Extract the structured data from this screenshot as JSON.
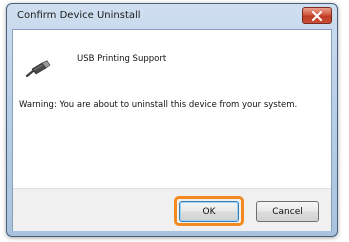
{
  "window": {
    "title": "Confirm Device Uninstall",
    "close_icon": "close-icon"
  },
  "device": {
    "icon": "usb-plug-icon",
    "name": "USB Printing Support"
  },
  "message": {
    "warning": "Warning: You are about to uninstall this device from your system."
  },
  "buttons": {
    "ok_label": "OK",
    "cancel_label": "Cancel"
  },
  "colors": {
    "highlight": "#f28a1f",
    "close_button": "#c9503a"
  }
}
